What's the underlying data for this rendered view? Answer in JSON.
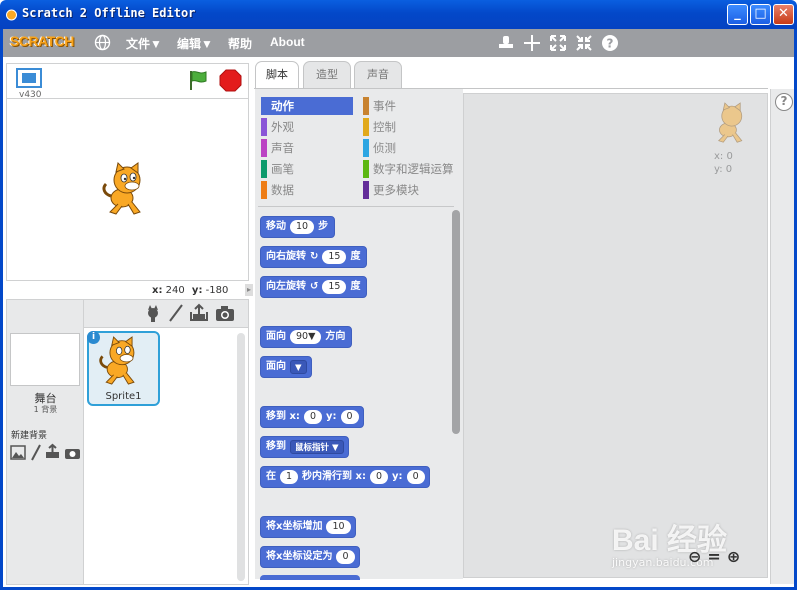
{
  "window": {
    "title": "Scratch 2 Offline Editor",
    "minimize": "_",
    "maximize": "□",
    "close": "✕"
  },
  "menubar": {
    "logo": "SCRATCH",
    "items": [
      "文件▼",
      "编辑▼",
      "帮助",
      "About"
    ]
  },
  "stage": {
    "version": "v430",
    "x_label": "x:",
    "x_value": "240",
    "y_label": "y:",
    "y_value": "-180"
  },
  "sprites": {
    "stage_label": "舞台",
    "stage_sublabel": "1 背景",
    "new_backdrop_label": "新建背景",
    "sprite_name": "Sprite1",
    "info_badge": "i"
  },
  "tabs": [
    "脚本",
    "造型",
    "声音"
  ],
  "categories": {
    "left": [
      {
        "label": "动作",
        "color": "#4a6cd4"
      },
      {
        "label": "外观",
        "color": "#8a55d7"
      },
      {
        "label": "声音",
        "color": "#bb42c3"
      },
      {
        "label": "画笔",
        "color": "#0e9a6c"
      },
      {
        "label": "数据",
        "color": "#ee7d16"
      }
    ],
    "right": [
      {
        "label": "事件",
        "color": "#c88330"
      },
      {
        "label": "控制",
        "color": "#e1a91a"
      },
      {
        "label": "侦测",
        "color": "#2ca5e2"
      },
      {
        "label": "数字和逻辑运算",
        "color": "#5cb712"
      },
      {
        "label": "更多模块",
        "color": "#632d99"
      }
    ]
  },
  "blocks": {
    "move": {
      "label": "移动",
      "value": "10",
      "suffix": "步"
    },
    "turn_right": {
      "label": "向右旋转",
      "value": "15",
      "suffix": "度"
    },
    "turn_left": {
      "label": "向左旋转",
      "value": "15",
      "suffix": "度"
    },
    "point_dir": {
      "label": "面向",
      "value": "90▼",
      "suffix": "方向"
    },
    "point_towards": {
      "label": "面向",
      "value": "▼"
    },
    "goto_xy": {
      "label": "移到 x:",
      "x": "0",
      "y_label": "y:",
      "y": "0"
    },
    "goto": {
      "label": "移到",
      "value": "鼠标指针 ▼"
    },
    "glide": {
      "label": "在",
      "secs": "1",
      "mid": "秒内滑行到 x:",
      "x": "0",
      "y_label": "y:",
      "y": "0"
    },
    "change_x": {
      "label": "将x坐标增加",
      "value": "10"
    },
    "set_x": {
      "label": "将x坐标设定为",
      "value": "0"
    }
  },
  "script_area": {
    "x_readout": "x: 0",
    "y_readout": "y: 0",
    "help": "?",
    "zoom_out": "⊖",
    "zoom_reset": "=",
    "zoom_in": "⊕"
  },
  "watermark": {
    "text": "Bai 经验",
    "url": "jingyan.baidu.com"
  },
  "colors": {
    "motion": "#4a6cd4",
    "titlebar": "#0348c9",
    "menubar": "#9c9ea2",
    "logo": "#f7a21a"
  }
}
